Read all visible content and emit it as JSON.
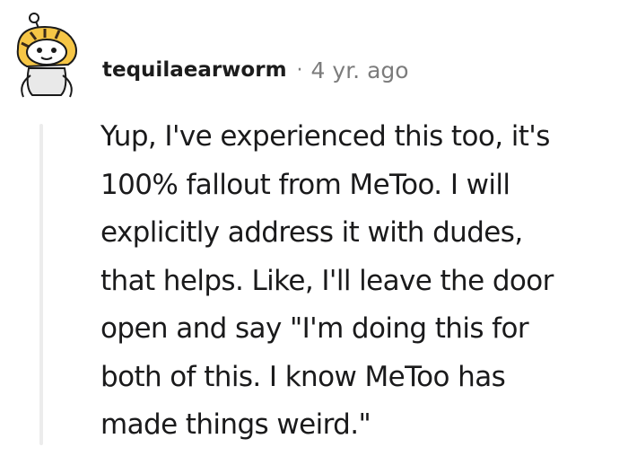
{
  "comment": {
    "username": "tequilaearworm",
    "separator": "·",
    "timestamp": "4 yr. ago",
    "body_lines": [
      "Yup, I've experienced this too, it's",
      "100% fallout from MeToo. I will",
      "explicitly address it with dudes,",
      "that helps. Like, I'll leave the door",
      "open and say \"I'm doing this for",
      "both of this. I know MeToo has",
      "made things weird.\""
    ]
  },
  "avatar": {
    "icon": "snoo-tiger-avatar-icon",
    "colors": {
      "fur": "#f6c646",
      "stripes": "#3a2a1a",
      "face": "#ffffff",
      "outline": "#1a1a1a",
      "background": "#e9e9e9"
    }
  },
  "colors": {
    "text": "#1a1a1b",
    "meta": "#7c7c7c",
    "thread_line": "#ececec"
  }
}
